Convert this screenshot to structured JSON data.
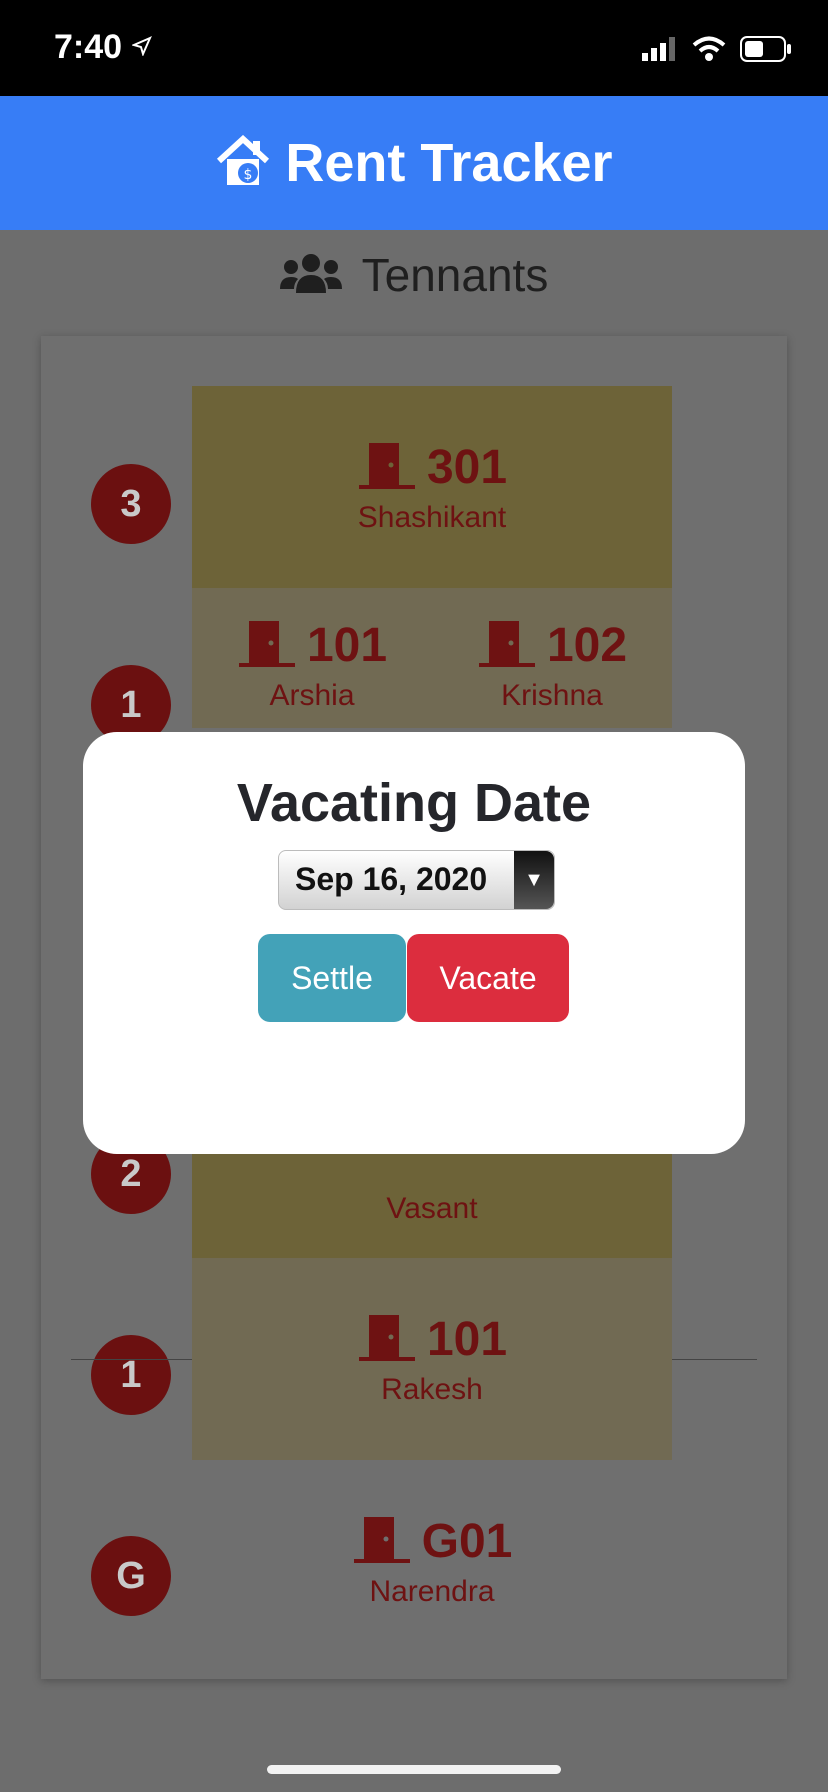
{
  "status_bar": {
    "time": "7:40"
  },
  "header": {
    "title": "Rent Tracker"
  },
  "section": {
    "title": "Tennants"
  },
  "floors": [
    {
      "label": "3"
    },
    {
      "label": "1"
    },
    {
      "label": "2"
    },
    {
      "label": "1"
    },
    {
      "label": "G"
    }
  ],
  "units": [
    {
      "number": "301",
      "tenant": "Shashikant"
    },
    {
      "number": "101",
      "tenant": "Arshia"
    },
    {
      "number": "102",
      "tenant": "Krishna"
    },
    {
      "number": "",
      "tenant": "Vasant"
    },
    {
      "number": "101",
      "tenant": "Rakesh"
    },
    {
      "number": "G01",
      "tenant": "Narendra"
    }
  ],
  "modal": {
    "title": "Vacating Date",
    "date_value": "Sep 16, 2020",
    "settle_label": "Settle",
    "vacate_label": "Vacate"
  },
  "colors": {
    "header_bg": "#377df6",
    "settle": "#43a2b8",
    "vacate": "#dc2d3e",
    "accent_dark_red": "#6b1010"
  },
  "icons": [
    "location-arrow-icon",
    "signal-icon",
    "wifi-icon",
    "battery-icon",
    "house-dollar-icon",
    "users-icon",
    "door-icon",
    "dropdown-arrow-icon"
  ]
}
